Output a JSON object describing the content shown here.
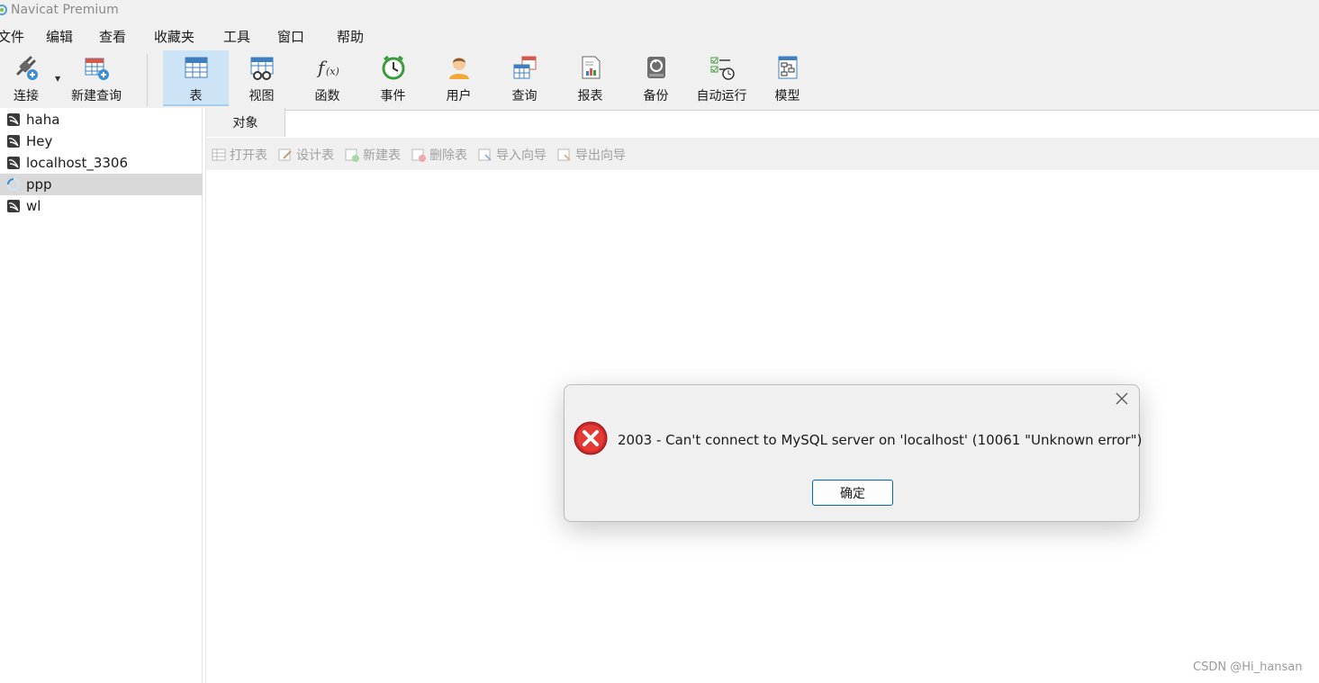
{
  "window": {
    "title": "Navicat Premium"
  },
  "menu": [
    "文件",
    "编辑",
    "查看",
    "收藏夹",
    "工具",
    "窗口",
    "帮助"
  ],
  "toolbar": {
    "connect": "连接",
    "new_query": "新建查询",
    "table": "表",
    "view": "视图",
    "function": "函数",
    "event": "事件",
    "user": "用户",
    "query": "查询",
    "report": "报表",
    "backup": "备份",
    "automation": "自动运行",
    "model": "模型"
  },
  "connections": [
    {
      "name": "haha",
      "icon": "mysql-connection-icon"
    },
    {
      "name": "Hey",
      "icon": "mysql-connection-icon"
    },
    {
      "name": "localhost_3306",
      "icon": "mysql-connection-icon"
    },
    {
      "name": "ppp",
      "icon": "loading-spinner-icon",
      "selected": true
    },
    {
      "name": "wl",
      "icon": "mysql-connection-icon"
    }
  ],
  "tabs": {
    "objects": "对象"
  },
  "object_toolbar": {
    "open_table": "打开表",
    "design_table": "设计表",
    "new_table": "新建表",
    "delete_table": "删除表",
    "import_wizard": "导入向导",
    "export_wizard": "导出向导"
  },
  "dialog": {
    "message": "2003 - Can't connect to MySQL server on 'localhost' (10061 \"Unknown error\")",
    "ok_label": "确定",
    "icon": "error-icon"
  },
  "watermark": "CSDN @Hi_hansan",
  "colors": {
    "accent": "#0067c0",
    "error": "#d32f2f",
    "active_tab": "#cde4f7"
  }
}
